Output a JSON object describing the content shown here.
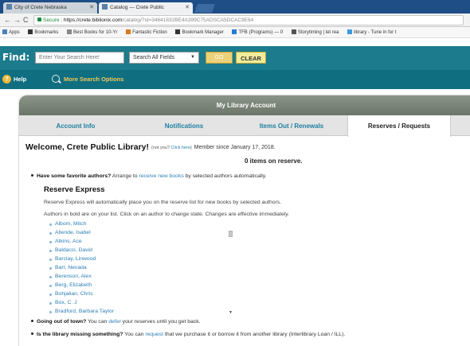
{
  "browser": {
    "tabs": [
      {
        "label": "City of Crete Nebraska"
      },
      {
        "label": "Catalog — Crete Public"
      }
    ],
    "url_secure": "Secure",
    "url_host": "https://crete.biblionix.com",
    "url_path": "/catalog/?st=34641832BE4A399C75ADSCA5DCAC9E64",
    "bookmarks": [
      {
        "label": "Apps",
        "icon": "apps-icon"
      },
      {
        "label": "Bookmarks",
        "icon": "star-icon"
      },
      {
        "label": "Best Books for 10-Yr",
        "icon": "arrow-icon"
      },
      {
        "label": "Fantastic Fiction",
        "icon": "grid-icon"
      },
      {
        "label": "Bookmark Manager",
        "icon": "star-icon"
      },
      {
        "label": "TFB (Programs) — 0",
        "icon": "tf-icon"
      },
      {
        "label": "Storytiming | let rea",
        "icon": "st-icon"
      },
      {
        "label": "library - Tune in for t",
        "icon": "lib-icon"
      }
    ]
  },
  "search": {
    "find_label": "Find:",
    "placeholder": "Enter Your Search Here!",
    "field_select": "Search All Fields",
    "go_label": "GO",
    "clear_label": "CLEAR"
  },
  "help": {
    "help_label": "Help",
    "more_options_label": "More Search Options"
  },
  "account": {
    "title": "My Library Account",
    "tabs": [
      "Account Info",
      "Notifications",
      "Items Out / Renewals",
      "Reserves / Requests"
    ],
    "welcome": "Welcome, Crete Public Library!",
    "not_you": "(not you?",
    "click_here": "Click here",
    "not_you_close": ")",
    "member_since": "Member since January 17, 2018.",
    "items_on_reserve": "0 items on reserve."
  },
  "favorites": {
    "question": "Have some favorite authors?",
    "text_a": "Arrange to",
    "link": "receive new books",
    "text_b": "by selected authors automatically.",
    "express_title": "Reserve Express",
    "express_line1": "Reserve Express will automatically place you on the reserve list for new books by selected authors.",
    "express_line2": "Authors in bold are on your list. Click on an author to change state. Changes are effective immediately.",
    "authors": [
      "Albom, Mitch",
      "Allende, Isabel",
      "Atkins, Ace",
      "Baldacci, David",
      "Barclay, Linwood",
      "Barr, Nevada",
      "Berenson, Alex",
      "Berg, Elizabeth",
      "Bohjalian, Chris",
      "Box, C. J",
      "Bradford, Barbara Taylor"
    ]
  },
  "out_of_town": {
    "question": "Going out of town?",
    "text_a": "You can",
    "link": "defer",
    "text_b": "your reserves until you get back."
  },
  "missing": {
    "question": "Is the library missing something?",
    "text_a": "You can",
    "link": "request",
    "text_b": "that we purchase it or borrow it from another library (Interlibrary Loan / ILL)."
  }
}
